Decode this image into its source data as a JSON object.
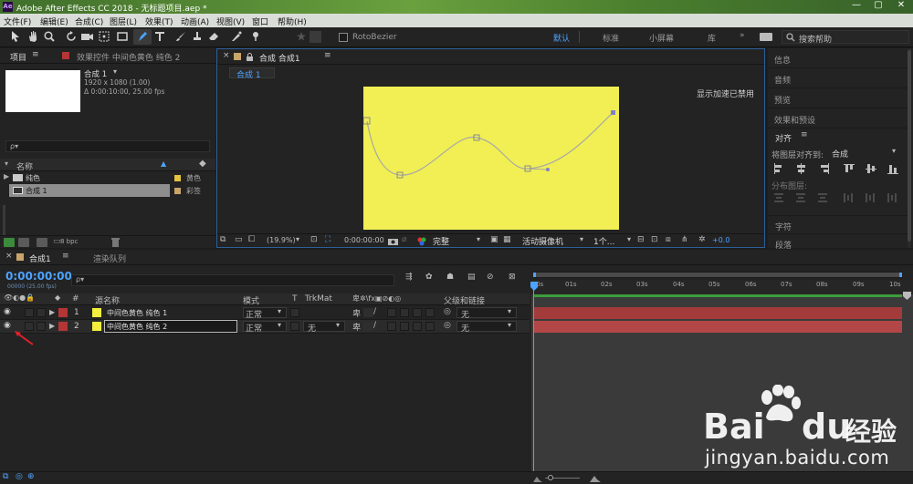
{
  "app": {
    "title": "Adobe After Effects CC 2018 - 无标题项目.aep *",
    "menu": [
      "文件(F)",
      "编辑(E)",
      "合成(C)",
      "图层(L)",
      "效果(T)",
      "动画(A)",
      "视图(V)",
      "窗口",
      "帮助(H)"
    ]
  },
  "toolbar": {
    "rotobezier_label": "RotoBezier",
    "workspaces": [
      "默认",
      "标准",
      "小屏幕",
      "库"
    ],
    "active_workspace": "默认",
    "search_placeholder": "搜索帮助"
  },
  "project_panel": {
    "tab_label": "项目",
    "effects_tab_label": "效果控件 中间色黄色 纯色 2",
    "comp_name": "合成 1",
    "comp_dims": "1920 x 1080 (1.00)",
    "comp_duration": "Δ 0:00:10:00, 25.00 fps",
    "search_placeholder": "ρ▾",
    "col_name": "名称",
    "items": [
      {
        "name": "纯色",
        "type": "黄色",
        "swatch": "#e3c33f",
        "folder": true
      },
      {
        "name": "合成 1",
        "type": "彩签",
        "swatch": "#c9a56a",
        "selected": true
      }
    ],
    "bpc": "8 bpc"
  },
  "comp_panel": {
    "tab_label": "合成 合成1",
    "sub_tab": "合成 1",
    "gpu_notice": "显示加速已禁用",
    "zoom": "(19.9%)",
    "timecode": "0:00:00:00",
    "resolution": "完整",
    "camera": "活动摄像机",
    "views": "1个...",
    "exposure": "+0.0",
    "solid_color": "#f1ef53"
  },
  "right_panel": {
    "items": [
      "信息",
      "音频",
      "预览",
      "效果和预设"
    ],
    "align_title": "对齐",
    "align_to_label": "将图层对齐到:",
    "align_to_value": "合成",
    "distribute_label": "分布图层:",
    "bottom_items": [
      "字符",
      "段落"
    ]
  },
  "timeline": {
    "tab_label": "合成1",
    "render_queue_label": "渲染队列",
    "timecode": "0:00:00:00",
    "fps_label": "00000 (25.00 fps)",
    "search_placeholder": "ρ▾",
    "headers": {
      "num": "#",
      "source_name": "源名称",
      "mode": "模式",
      "t": "T",
      "trkmat": "TrkMat",
      "parent": "父级和链接"
    },
    "layers": [
      {
        "num": "1",
        "name": "中间色黄色 纯色 1",
        "mode": "正常",
        "trkmat": "",
        "parent": "无",
        "label_color": "#b53535",
        "swatch": "#f3ef3c"
      },
      {
        "num": "2",
        "name": "中间色黄色 纯色 2",
        "mode": "正常",
        "trkmat": "无",
        "parent": "无",
        "label_color": "#b53535",
        "swatch": "#f3ef3c",
        "selected": true
      }
    ],
    "ruler": [
      "0s",
      "01s",
      "02s",
      "03s",
      "04s",
      "05s",
      "06s",
      "07s",
      "08s",
      "09s",
      "10s"
    ]
  },
  "watermark": {
    "brand": "Bai",
    "brand_du": "du",
    "brand_cn": "经验",
    "url": "jingyan.baidu.com"
  }
}
